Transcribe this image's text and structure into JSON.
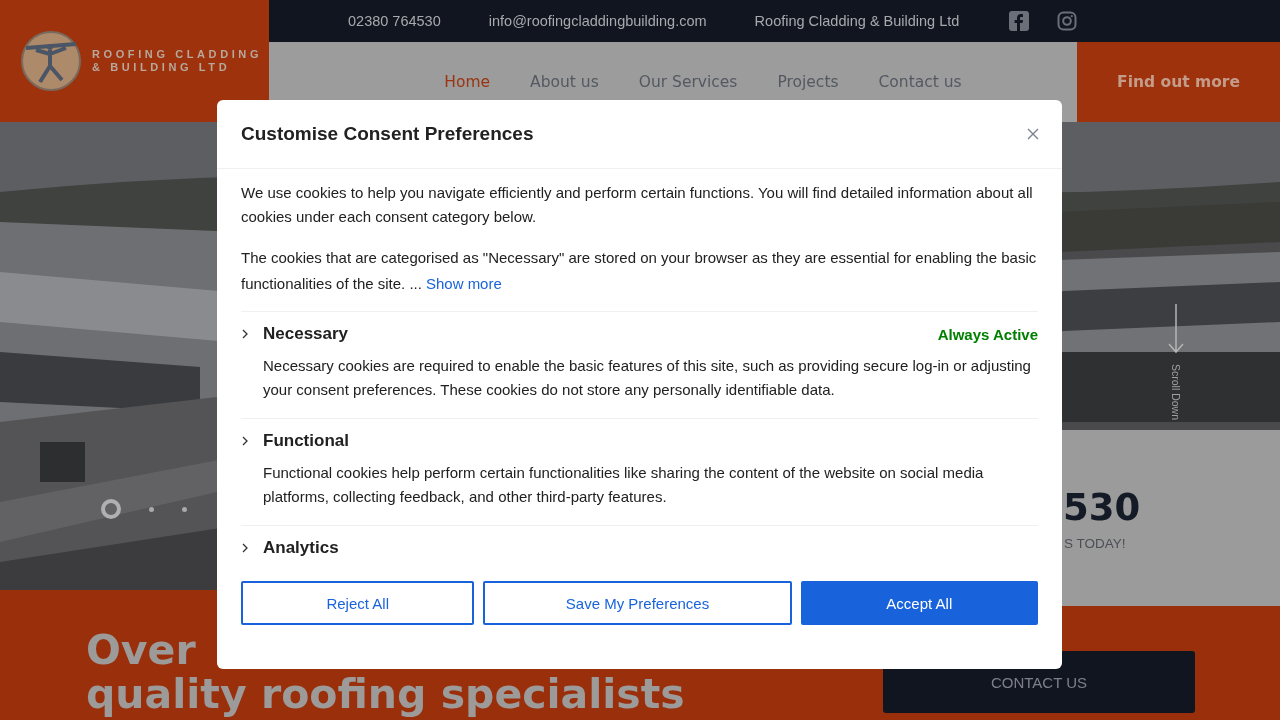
{
  "top_bar": {
    "phone": "02380 764530",
    "email": "info@roofingcladdingbuilding.com",
    "company": "Roofing Cladding & Building Ltd"
  },
  "logo": {
    "line_1": "ROOFING CLADDING",
    "line_2": "& BUILDING LTD"
  },
  "nav": [
    {
      "label": "Home",
      "selected": true
    },
    {
      "label": "About us",
      "selected": false
    },
    {
      "label": "Our Services",
      "selected": false
    },
    {
      "label": "Projects",
      "selected": false
    },
    {
      "label": "Contact us",
      "selected": false
    }
  ],
  "cta_button": "Find out more",
  "hero": {
    "kind": "picture",
    "carousel_dots": [
      {
        "selected": true
      },
      {
        "selected": false
      },
      {
        "selected": false
      }
    ],
    "scroll_hint": "Scroll Down"
  },
  "call_panel": {
    "number": "530",
    "caption": "S TODAY!"
  },
  "intro": {
    "headline_lines": [
      "Over",
      "quality roofing specialists"
    ],
    "button": "CONTACT US"
  },
  "consent_dialog": {
    "title": "Customise Consent Preferences",
    "paragraphs": [
      "We use cookies to help you navigate efficiently and perform certain functions. You will find detailed information about all cookies under each consent category below.",
      "The cookies that are categorised as \"Necessary\" are stored on your browser as they are essential for enabling the basic functionalities of the site. ..."
    ],
    "show_more": "Show more",
    "categories": [
      {
        "name": "Necessary",
        "status": "Always Active",
        "description": "Necessary cookies are required to enable the basic features of this site, such as providing secure log-in or adjusting your consent preferences. These cookies do not store any personally identifiable data."
      },
      {
        "name": "Functional",
        "description": "Functional cookies help perform certain functionalities like sharing the content of the website on social media platforms, collecting feedback, and other third-party features."
      },
      {
        "name": "Analytics"
      }
    ],
    "buttons": [
      {
        "label": "Reject All",
        "kind": "outline"
      },
      {
        "label": "Save My Preferences",
        "kind": "outline"
      },
      {
        "label": "Accept All",
        "kind": "primary"
      }
    ]
  }
}
